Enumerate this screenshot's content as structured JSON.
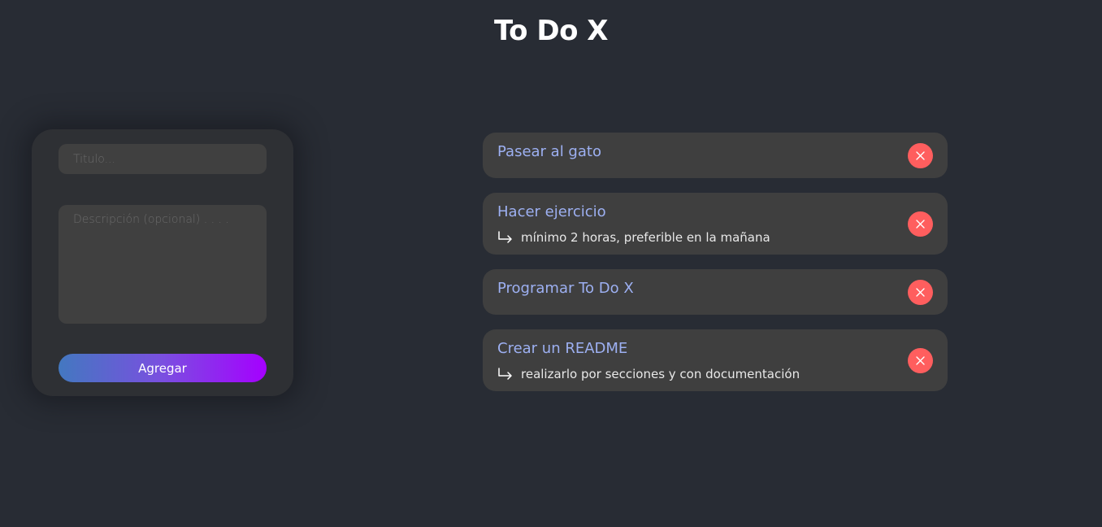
{
  "app": {
    "title": "To Do X"
  },
  "form": {
    "title_placeholder": "Titulo...",
    "title_value": "",
    "description_placeholder": "Descripción (opcional) . . . .",
    "description_value": "",
    "add_label": "Agregar"
  },
  "tasks": [
    {
      "title": "Pasear al gato",
      "description": ""
    },
    {
      "title": "Hacer ejercicio",
      "description": "mínimo 2 horas, preferible en la mañana"
    },
    {
      "title": "Programar To Do X",
      "description": ""
    },
    {
      "title": "Crear un README",
      "description": "realizarlo por secciones y con documentación"
    }
  ],
  "icons": {
    "description_arrow": "arrow-return-right-icon",
    "delete": "close-icon"
  },
  "colors": {
    "background": "#282c34",
    "card": "#3f3f3f",
    "task_title": "#9db0f2",
    "delete": "#ff5e5e",
    "gradient_start": "#4378c0",
    "gradient_end": "#a500ff"
  }
}
